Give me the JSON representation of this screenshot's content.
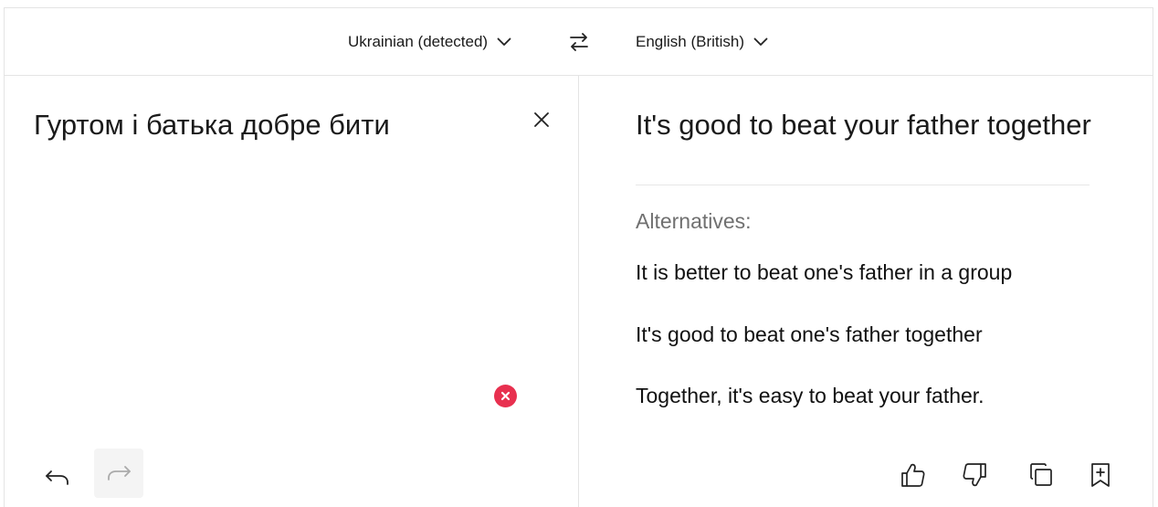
{
  "header": {
    "source_language": "Ukrainian (detected)",
    "target_language": "English (British)"
  },
  "source": {
    "text": "Гуртом і батька добре бити"
  },
  "target": {
    "translation": "It's good to beat your father together",
    "alternatives_heading": "Alternatives:",
    "alternatives": [
      "It is better to beat one's father in a group",
      "It's good to beat one's father together",
      "Together, it's easy to beat your father."
    ]
  },
  "colors": {
    "accent_error": "#e8304f",
    "border": "#e4e4e4",
    "muted_text": "#707070"
  },
  "icons": {
    "source_lang_dropdown": "chevron-down-icon",
    "target_lang_dropdown": "chevron-down-icon",
    "swap": "swap-arrows-icon",
    "clear": "close-icon",
    "error": "error-x-icon",
    "undo": "undo-icon",
    "redo": "redo-icon",
    "like": "thumbs-up-icon",
    "dislike": "thumbs-down-icon",
    "copy": "copy-icon",
    "save": "bookmark-add-icon"
  }
}
